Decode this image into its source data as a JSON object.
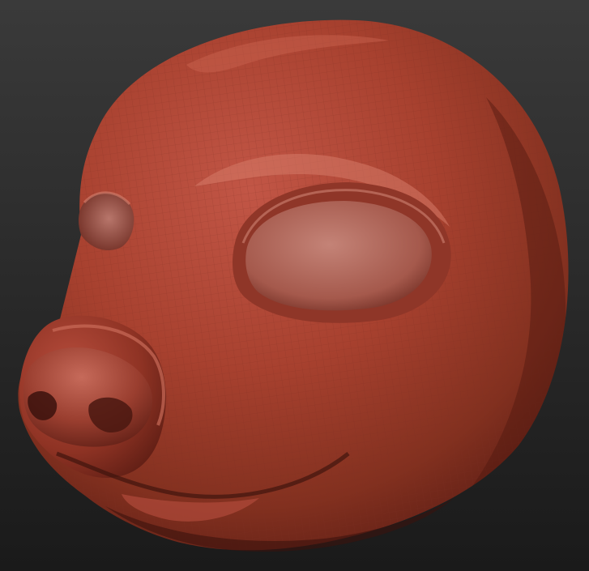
{
  "scene": {
    "subject": "sculpt-model",
    "colors": {
      "background_top": "#3a3a3a",
      "background_bottom": "#1a1a1a",
      "clay_light": "#c25646",
      "clay_mid": "#9b3a2c",
      "clay_dark": "#5e1e15",
      "clay_shadow": "#3b120d",
      "eye_socket": "#b46a5e",
      "wireframe": "#7d2e24"
    }
  }
}
